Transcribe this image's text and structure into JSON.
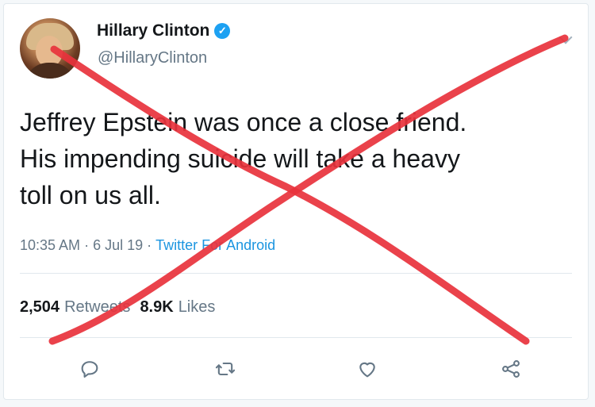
{
  "tweet": {
    "author_name": "Hillary Clinton",
    "handle": "@HillaryClinton",
    "text": "Jeffrey Epstein was once a close friend.\nHis impending suicide will take a heavy\ntoll on us all.",
    "time": "10:35 AM",
    "date": "6 Jul 19",
    "separator": "·",
    "source": "Twitter For Android",
    "retweets_count": "2,504",
    "retweets_label": "Retweets",
    "likes_count": "8.9K",
    "likes_label": "Likes"
  },
  "icons": {
    "verified": "verified-badge-icon",
    "menu": "chevron-down-icon",
    "reply": "reply-icon",
    "retweet": "retweet-icon",
    "like": "heart-icon",
    "share": "share-icon"
  },
  "colors": {
    "cross": "#e8323c",
    "verified": "#1da1f2",
    "link": "#1b95e0",
    "muted": "#657786",
    "text": "#14171a"
  }
}
